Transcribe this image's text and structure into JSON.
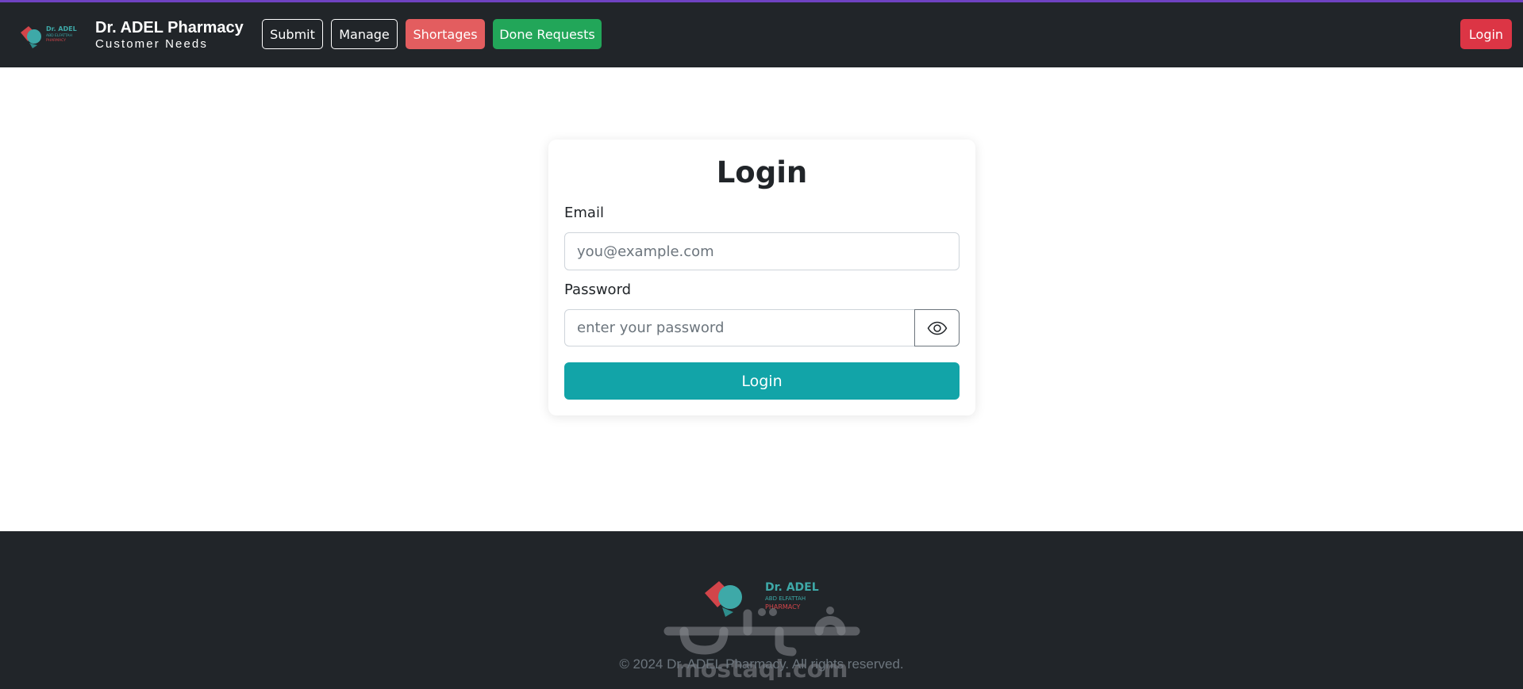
{
  "brand": {
    "title": "Dr. ADEL Pharmacy",
    "subtitle": "Customer Needs",
    "logo_name": "Dr. ADEL",
    "logo_line2": "ABD ELFATTAH",
    "logo_line3": "PHARMACY"
  },
  "nav": {
    "submit": "Submit",
    "manage": "Manage",
    "shortages": "Shortages",
    "done_requests": "Done Requests",
    "login": "Login"
  },
  "form": {
    "title": "Login",
    "email_label": "Email",
    "email_placeholder": "you@example.com",
    "password_label": "Password",
    "password_placeholder": "enter your password",
    "password_toggle_icon": "eye-icon",
    "submit_label": "Login"
  },
  "footer": {
    "copyright": "© 2024 Dr. ADEL Pharmacy. All rights reserved.",
    "watermark_text": "mostaql.com"
  },
  "colors": {
    "navbar": "#212529",
    "accent_teal": "#12a4a8",
    "shortages": "#e35d5f",
    "done": "#22a659",
    "login_red": "#dc3545",
    "top_line": "#6f42c1"
  }
}
